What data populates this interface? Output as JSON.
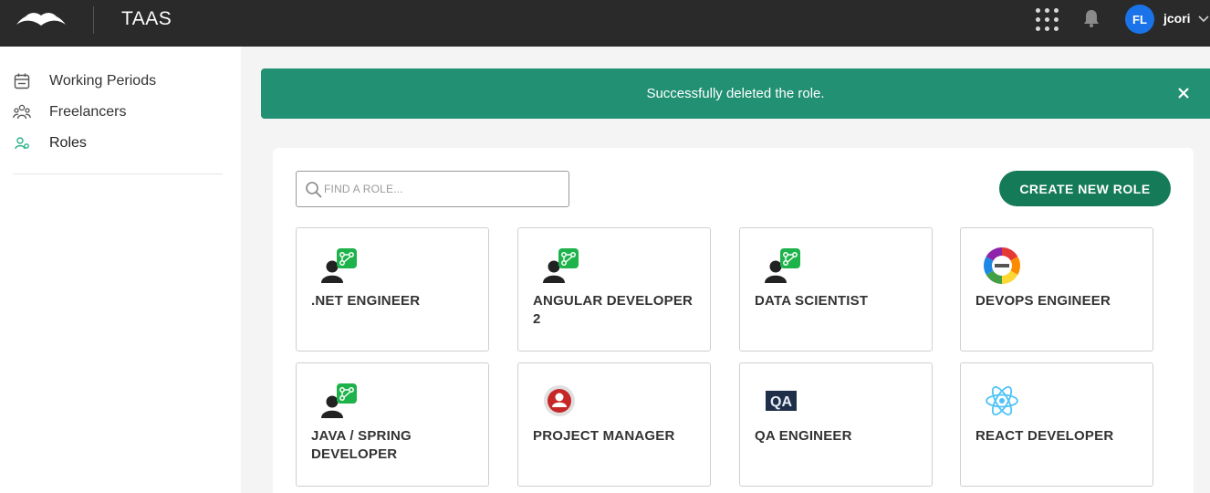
{
  "header": {
    "app_title": "TAAS",
    "avatar_initials": "FL",
    "username": "jcori"
  },
  "sidebar": {
    "items": [
      {
        "label": "Working Periods",
        "icon": "calendar-icon"
      },
      {
        "label": "Freelancers",
        "icon": "people-icon"
      },
      {
        "label": "Roles",
        "icon": "role-icon",
        "active": true
      }
    ]
  },
  "toast": {
    "message": "Successfully deleted the role."
  },
  "roles_panel": {
    "search_placeholder": "FIND A ROLE...",
    "create_button_label": "CREATE NEW ROLE",
    "roles": [
      {
        "name": ".NET ENGINEER",
        "icon": "person-code-icon"
      },
      {
        "name": "ANGULAR DEVELOPER 2",
        "icon": "person-code-icon"
      },
      {
        "name": "DATA SCIENTIST",
        "icon": "person-code-icon"
      },
      {
        "name": "DEVOPS ENGINEER",
        "icon": "devops-wheel-icon"
      },
      {
        "name": "JAVA / SPRING DEVELOPER",
        "icon": "person-code-icon"
      },
      {
        "name": "PROJECT MANAGER",
        "icon": "project-manager-icon"
      },
      {
        "name": "QA ENGINEER",
        "icon": "qa-badge-icon"
      },
      {
        "name": "REACT DEVELOPER",
        "icon": "react-atom-icon"
      }
    ]
  },
  "colors": {
    "topbar": "#2a2a2a",
    "toast": "#229073",
    "primary_button": "#147a58",
    "avatar": "#1a73e8",
    "active_nav_icon": "#2bb38a"
  }
}
